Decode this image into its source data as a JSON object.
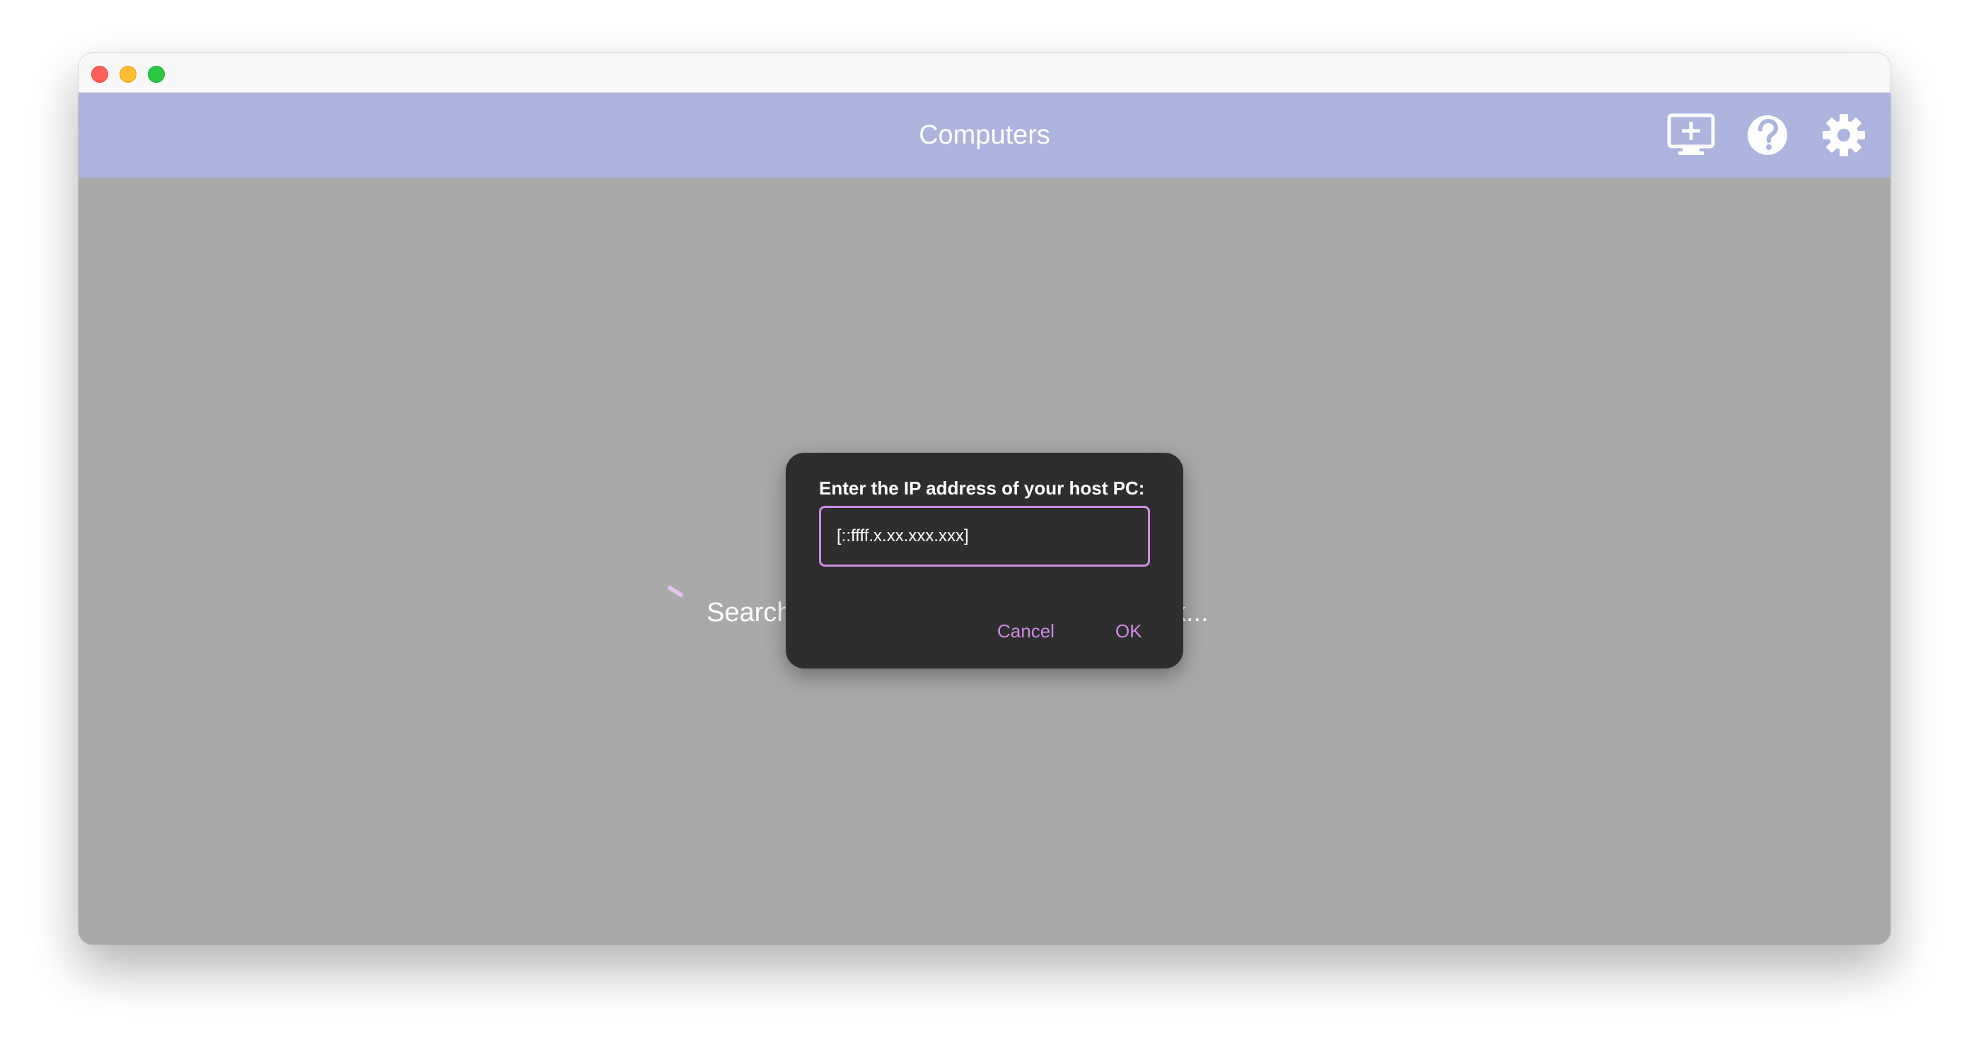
{
  "window": {
    "controls": {
      "close": "close-traffic-light",
      "minimize": "minimize-traffic-light",
      "zoom": "zoom-traffic-light"
    }
  },
  "appbar": {
    "title": "Computers",
    "actions": [
      {
        "icon": "add-computer-icon"
      },
      {
        "icon": "help-icon"
      },
      {
        "icon": "settings-icon"
      }
    ]
  },
  "content": {
    "status_text": "Searching for PCs on your local network..."
  },
  "dialog": {
    "title": "Enter the IP address of your host PC:",
    "input": {
      "value": "",
      "placeholder": "[::ffff.x.xx.xxx.xxx]"
    },
    "cancel_label": "Cancel",
    "ok_label": "OK"
  },
  "colors": {
    "appbar_background": "#abb3de",
    "content_background": "#a9a9a9",
    "dialog_background": "#2e2e2e",
    "accent": "#d08be7"
  }
}
